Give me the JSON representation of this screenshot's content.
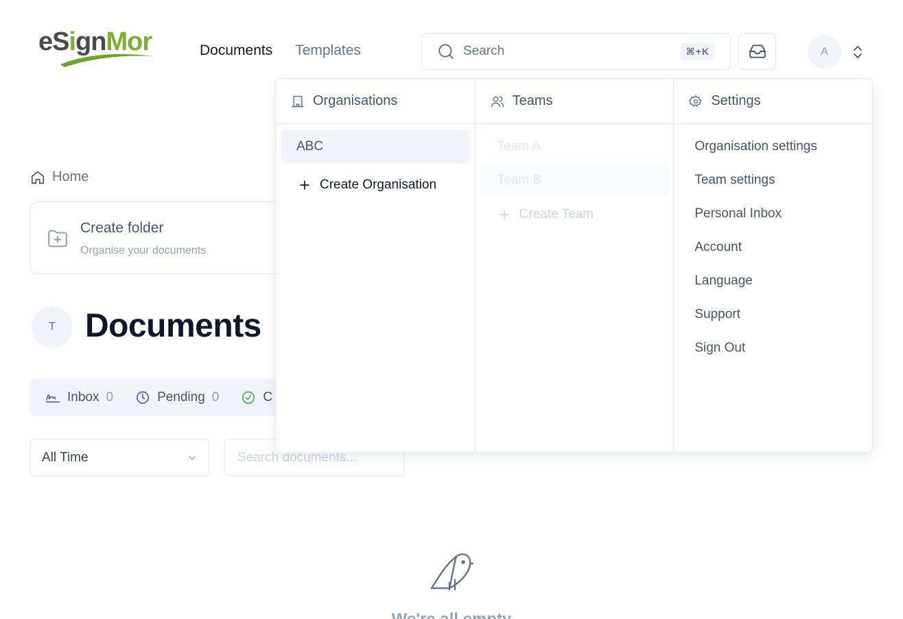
{
  "app": {
    "logo_left": "eS",
    "logo_i": "i",
    "logo_gn": "gn",
    "logo_mor": "Mor"
  },
  "nav": {
    "documents": "Documents",
    "templates": "Templates"
  },
  "search": {
    "label": "Search",
    "shortcut": "⌘+K"
  },
  "user": {
    "avatar_initial": "A"
  },
  "breadcrumb": {
    "home": "Home"
  },
  "folder": {
    "title": "Create folder",
    "subtitle": "Organise your documents"
  },
  "documents": {
    "team_initial": "T",
    "title": "Documents",
    "tabs": [
      {
        "label": "Inbox",
        "count": "0"
      },
      {
        "label": "Pending",
        "count": "0"
      },
      {
        "label": "C",
        "count": ""
      }
    ],
    "time_filter": "All Time",
    "search_placeholder": "Search documents..."
  },
  "empty": {
    "text": "We're all empty"
  },
  "dropdown": {
    "organisations": {
      "header": "Organisations",
      "items": [
        "ABC"
      ],
      "create": "Create Organisation"
    },
    "teams": {
      "header": "Teams",
      "items": [
        "Team A",
        "Team B"
      ],
      "create": "Create Team"
    },
    "settings": {
      "header": "Settings",
      "items": [
        "Organisation settings",
        "Team settings",
        "Personal Inbox",
        "Account",
        "Language",
        "Support",
        "Sign Out"
      ]
    }
  },
  "colors": {
    "brand_green": "#7fb02d",
    "brand_grey": "#4b4b4b",
    "inbox_icon": "#475569",
    "pending_icon": "#3b63d9",
    "completed_icon": "#4caf50"
  },
  "icons": {
    "search": "search-icon",
    "inbox": "inbox-tray-icon",
    "chevrons": "chevrons-up-down-icon",
    "home": "home-icon",
    "folder": "folder-plus-icon",
    "signature": "signature-icon",
    "clock": "clock-icon",
    "check": "check-circle-icon",
    "organisations": "building-icon",
    "teams": "users-icon",
    "settings": "gear-icon",
    "plus": "plus-icon",
    "bird": "bird-icon"
  }
}
